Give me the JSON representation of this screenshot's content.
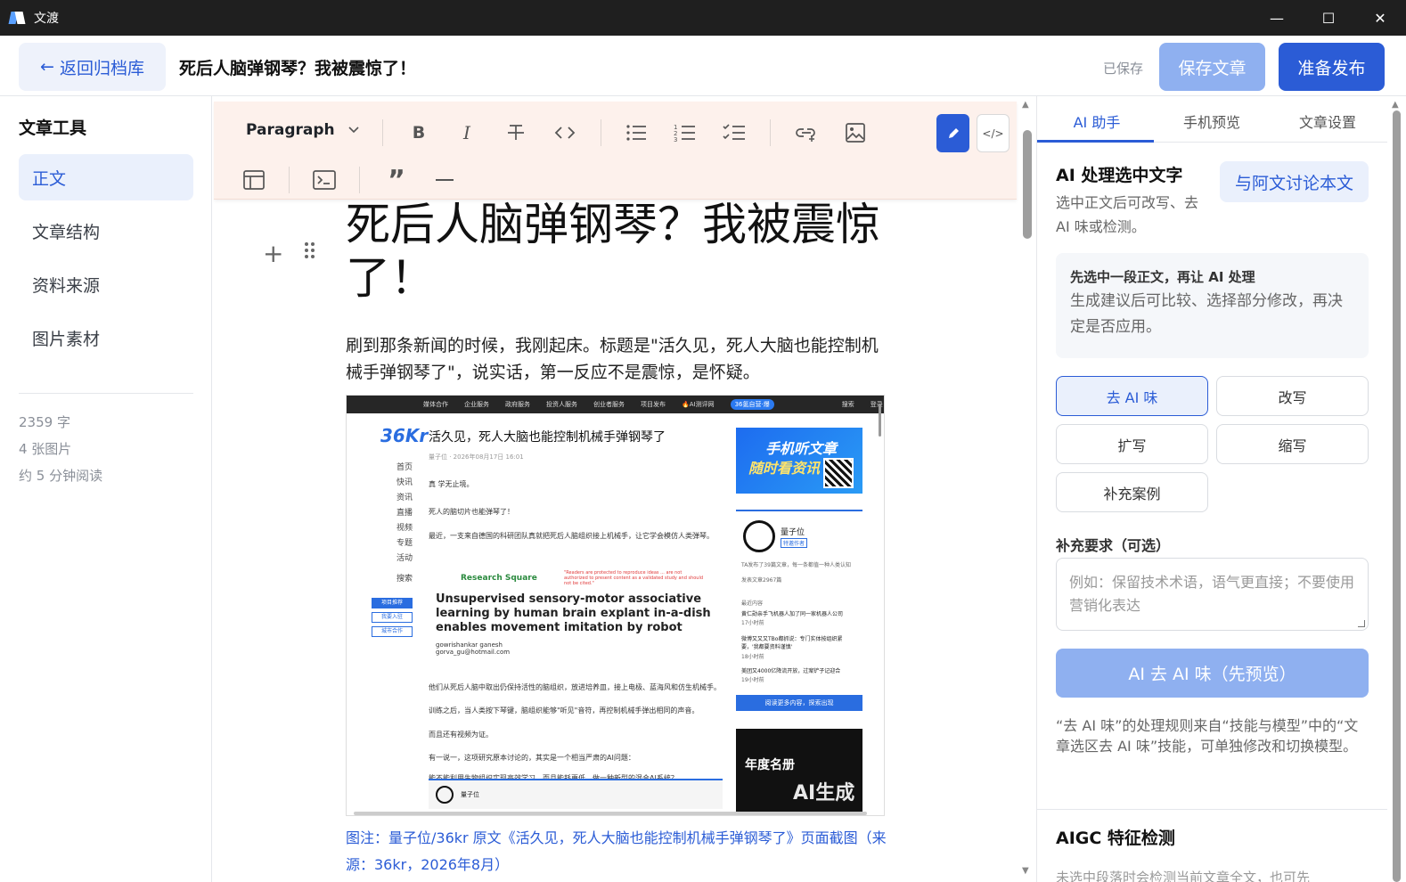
{
  "window": {
    "app_title": "文渡",
    "minimize_icon": "—",
    "maximize_icon": "☐",
    "close_icon": "✕"
  },
  "header": {
    "back_label": "返回归档库",
    "back_arrow": "←",
    "doc_title": "死后人脑弹钢琴？我被震惊了！",
    "saved_status": "已保存",
    "save_label": "保存文章",
    "publish_label": "准备发布"
  },
  "sidebar": {
    "heading": "文章工具",
    "items": [
      {
        "label": "正文",
        "active": true
      },
      {
        "label": "文章结构",
        "active": false
      },
      {
        "label": "资料来源",
        "active": false
      },
      {
        "label": "图片素材",
        "active": false
      }
    ],
    "stats": [
      "2359 字",
      "4 张图片",
      "约 5 分钟阅读"
    ]
  },
  "toolbar": {
    "paragraph_label": "Paragraph",
    "code_toggle_label": "</>"
  },
  "article": {
    "title": "死后人脑弹钢琴？我被震惊了！",
    "paragraph": "刷到那条新闻的时候，我刚起床。标题是\"活久见，死人大脑也能控制机械手弹钢琴了\"，说实话，第一反应不是震惊，是怀疑。",
    "caption": "图注：量子位/36kr 原文《活久见，死人大脑也能控制机械手弹钢琴了》页面截图（来源：36kr，2026年8月）",
    "screenshot": {
      "nav": [
        "媒体合作",
        "企业服务",
        "政府服务",
        "投资人服务",
        "创业者服务",
        "项目发布",
        "🔥AI测评网",
        "36氪自营·爆"
      ],
      "nav_right": [
        "搜索",
        "登录"
      ],
      "logo": "36Kr",
      "side_nav": [
        "首页",
        "快讯",
        "资讯",
        "直播",
        "视频",
        "专题",
        "活动",
        "搜索"
      ],
      "side_tags": [
        "项目推荐",
        "我要入驻",
        "城市合作"
      ],
      "headline": "活久见，死人大脑也能控制机械手弹钢琴了",
      "meta": "量子位 · 2026年08月17日 16:01",
      "lines": [
        "真 学无止境。",
        "死人的脑切片也能弹琴了！",
        "最近，一支来自德国的科研团队真就把死后人脑组织接上机械手，让它学会模仿人类弹琴。",
        "他们从死后人脑中取出仍保持活性的脑组织，放进培养皿，接上电极、蓝海风和仿生机械手。",
        "训练之后，当人类按下琴键，脑组织能够\"听见\"音符，再控制机械手弹出相同的声音。",
        "而且还有视频为证。",
        "有一说一，这项研究原本讨论的，其实是一个相当严肃的AI问题：",
        "能不能利用生物组织实现高效学习，而且能耗更低，做一种新型的混合AI系统？"
      ],
      "research_square": "Research Square",
      "rs_note": "\"Readers are protected to reproduce ideas ... are not authorized to present content as a validated study and should not be cited.\"",
      "paper_title": "Unsupervised sensory-motor associative learning by human brain explant in-a-dish enables movement imitation by robot",
      "author": "gowrishankar ganesh",
      "author_email": "gorva_gu@hotmail.com",
      "banner_line1": "手机听文章",
      "banner_line2": "随时看资讯",
      "card_name": "量子位",
      "card_tag": "特邀作者",
      "card_lines": [
        "TA发布了39篇文章，每一条都值一种人类认知",
        "发表文章2967篇",
        "最近内容",
        "黄仁勋亲手飞机器人加了同一家机器人公司",
        "17小时前",
        "微博又又又TBo都抓说：专门实体按组织紧要，'我都要资料谨慎'",
        "18小时前",
        "美团又4000亿降流开放，过案铲子记迎合",
        "19小时前"
      ],
      "card_button": "阅读更多内容，探索出现",
      "ad_line1": "年度名册",
      "ad_line2": "AI生成"
    }
  },
  "right_panel": {
    "tabs": [
      {
        "label": "AI 助手",
        "active": true
      },
      {
        "label": "手机预览",
        "active": false
      },
      {
        "label": "文章设置",
        "active": false
      }
    ],
    "ai_heading": "AI 处理选中文字",
    "ai_sub": "选中正文后可改写、去 AI 味或检测。",
    "discuss_label": "与阿文讨论本文",
    "hint_title": "先选中一段正文，再让 AI 处理",
    "hint_body": "生成建议后可比较、选择部分修改，再决定是否应用。",
    "actions": [
      {
        "label": "去 AI 味",
        "active": true
      },
      {
        "label": "改写",
        "active": false
      },
      {
        "label": "扩写",
        "active": false
      },
      {
        "label": "缩写",
        "active": false
      },
      {
        "label": "补充案例",
        "active": false
      }
    ],
    "req_label": "补充要求（可选）",
    "req_placeholder": "例如：保留技术术语，语气更直接；不要使用营销化表达",
    "run_label": "AI 去 AI 味（先预览）",
    "note": "“去 AI 味”的处理规则来自“技能与模型”中的“文章选区去 AI 味”技能，可单独修改和切换模型。",
    "aigc_heading": "AIGC 特征检测",
    "aigc_sub": "未选中段落时会检测当前文章全文，也可先"
  },
  "colors": {
    "accent": "#2b5cd6",
    "accent_light": "#8fb0f0",
    "toolbar_bg": "#fdf1ec"
  }
}
